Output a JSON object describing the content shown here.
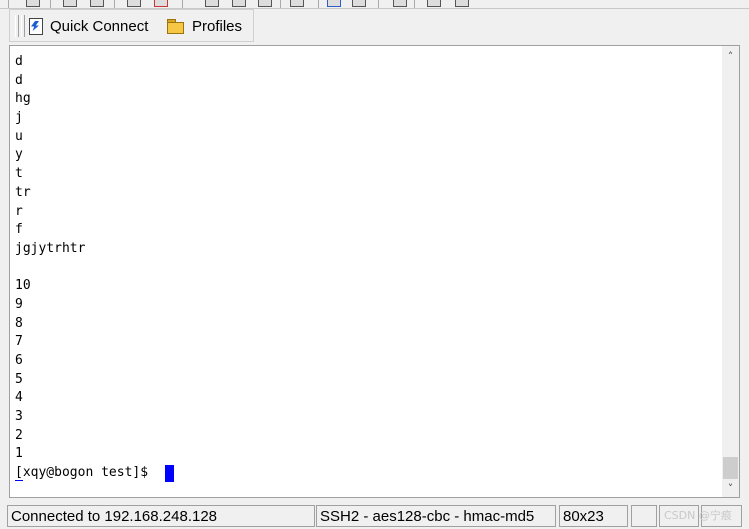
{
  "quick_bar": {
    "quick_connect_label": "Quick Connect",
    "profiles_label": "Profiles"
  },
  "terminal": {
    "lines": [
      "d",
      "d",
      "hg",
      "j",
      "u",
      "y",
      "t",
      "tr",
      "r",
      "f",
      "jgjytrhtr",
      "",
      "10",
      "9",
      "8",
      "7",
      "6",
      "5",
      "4",
      "3",
      "2",
      "1"
    ],
    "prompt": "[xqy@bogon test]$ ",
    "cursor_color": "#0000ff"
  },
  "status": {
    "connection": "Connected to 192.168.248.128",
    "cipher": "SSH2 - aes128-cbc - hmac-md5",
    "size": "80x23"
  },
  "watermark": "CSDN @宁痕"
}
